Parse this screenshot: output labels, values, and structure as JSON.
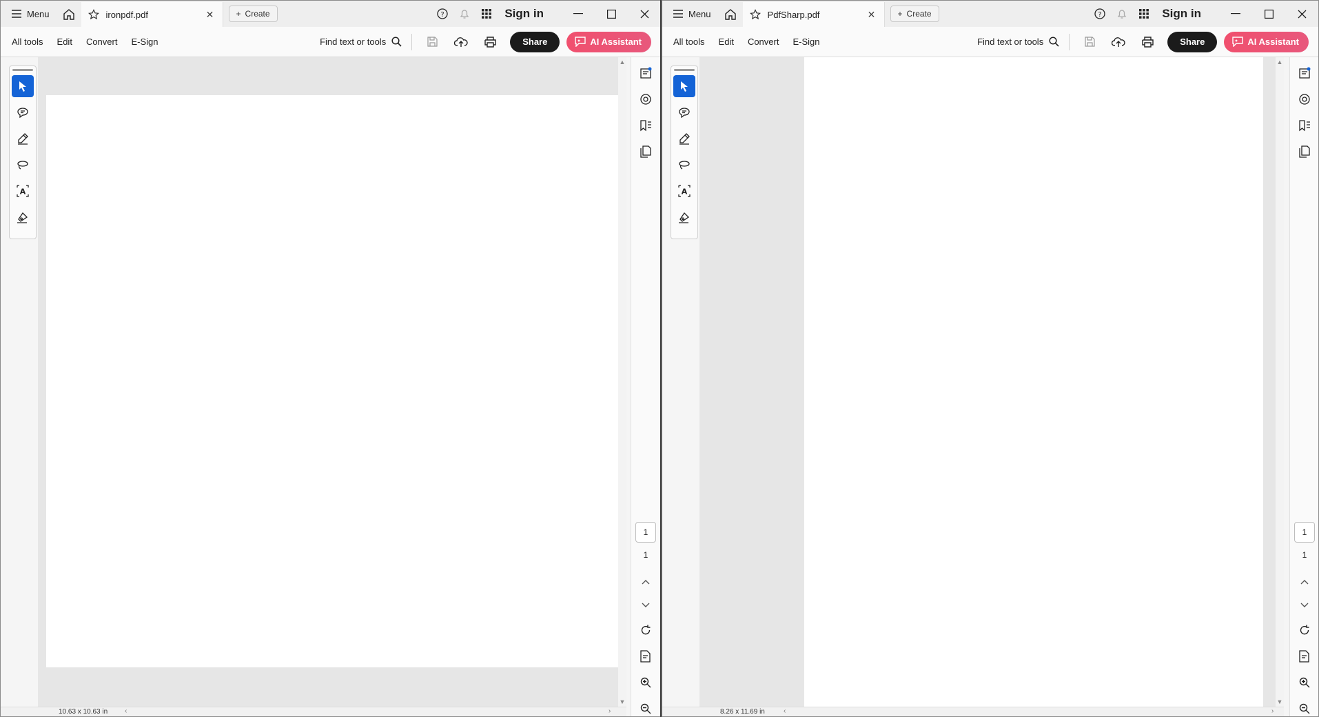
{
  "windows": [
    {
      "menu_label": "Menu",
      "tab_name": "ironpdf.pdf",
      "create_label": "Create",
      "sign_in": "Sign in",
      "tools": [
        "All tools",
        "Edit",
        "Convert",
        "E-Sign"
      ],
      "find_label": "Find text or tools",
      "share_label": "Share",
      "ai_label": "AI Assistant",
      "current_page": "1",
      "total_pages": "1",
      "page_size": "10.63 x 10.63 in"
    },
    {
      "menu_label": "Menu",
      "tab_name": "PdfSharp.pdf",
      "create_label": "Create",
      "sign_in": "Sign in",
      "tools": [
        "All tools",
        "Edit",
        "Convert",
        "E-Sign"
      ],
      "find_label": "Find text or tools",
      "share_label": "Share",
      "ai_label": "AI Assistant",
      "current_page": "1",
      "total_pages": "1",
      "page_size": "8.26 x 11.69 in"
    }
  ],
  "colors": {
    "accent_blue": "#1463d6",
    "ai_pink": "#f0506e",
    "share_black": "#1b1b1b"
  }
}
